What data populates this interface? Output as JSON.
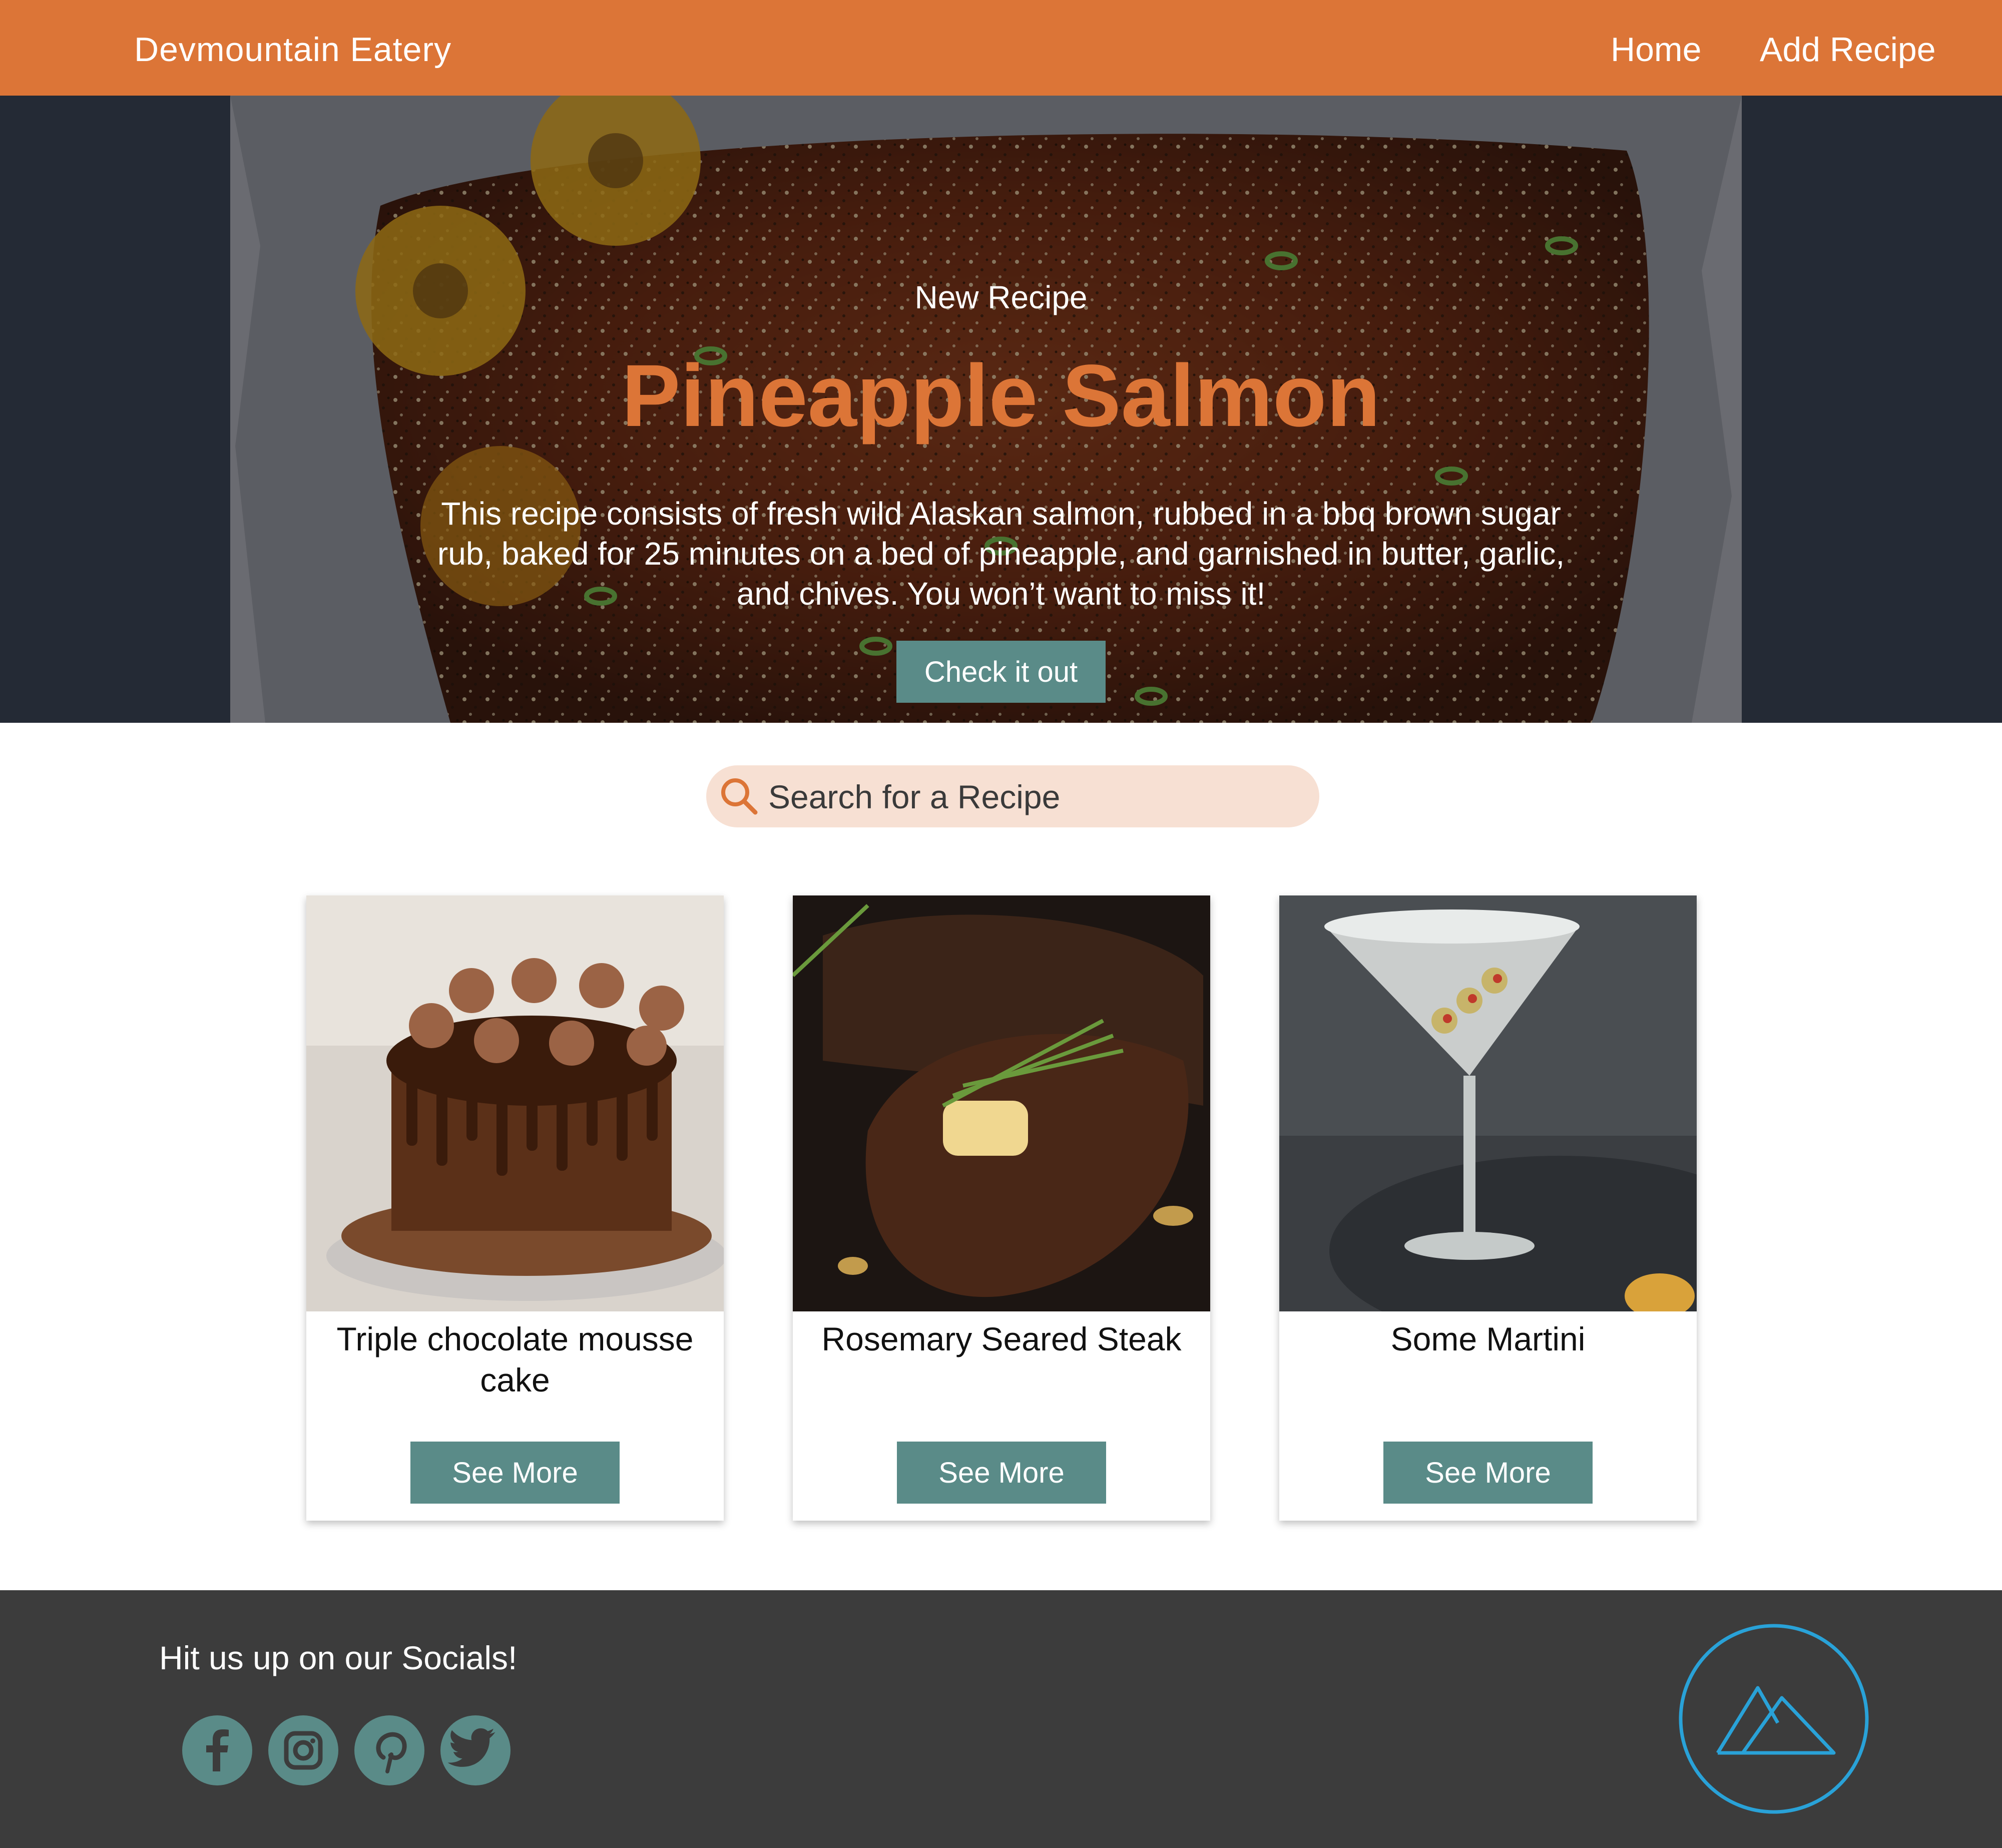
{
  "header": {
    "brand": "Devmountain Eatery",
    "nav": [
      {
        "label": "Home"
      },
      {
        "label": "Add Recipe"
      }
    ]
  },
  "hero": {
    "tag": "New Recipe",
    "title": "Pineapple Salmon",
    "description": "This recipe consists of fresh wild Alaskan salmon, rubbed in a bbq brown sugar rub, baked for 25 minutes on a bed of pineapple, and garnished in butter, garlic, and chives. You won’t want to miss it!",
    "button_label": "Check it out"
  },
  "search": {
    "placeholder": "Search for a Recipe"
  },
  "recipes": [
    {
      "title": "Triple chocolate mousse cake",
      "button_label": "See More"
    },
    {
      "title": "Rosemary Seared Steak",
      "button_label": "See More"
    },
    {
      "title": "Some Martini",
      "button_label": "See More"
    }
  ],
  "footer": {
    "text": "Hit us up on our Socials!",
    "socials": [
      "facebook-icon",
      "instagram-icon",
      "pinterest-icon",
      "twitter-icon"
    ]
  },
  "colors": {
    "brand_orange": "#dc7537",
    "teal": "#5a8b88",
    "footer_bg": "#3c3c3c",
    "search_bg": "#f7e0d3",
    "logo_blue": "#29a2d8"
  }
}
